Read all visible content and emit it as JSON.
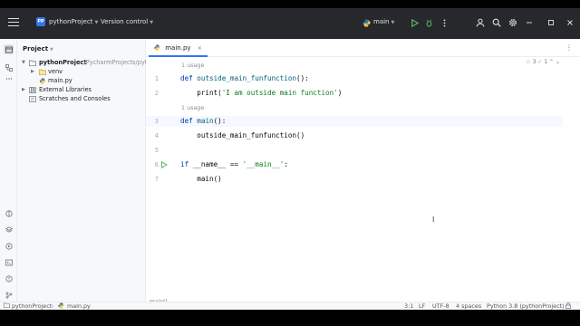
{
  "titlebar": {
    "project_badge": "PP",
    "project_name": "pythonProject",
    "vcs_label": "Version control",
    "run_config": "main",
    "icons": [
      "hamburger-menu-icon",
      "python-icon",
      "run-icon",
      "debug-icon",
      "more-icon",
      "user-icon",
      "search-icon",
      "settings-icon",
      "minimize-icon",
      "maximize-icon",
      "close-icon"
    ]
  },
  "project_panel": {
    "title": "Project",
    "tree": [
      {
        "label": "pythonProject",
        "sub": "~/PycharmProjects/pytho",
        "bold": true
      },
      {
        "label": "venv"
      },
      {
        "label": "main.py"
      },
      {
        "label": "External Libraries"
      },
      {
        "label": "Scratches and Consoles"
      }
    ]
  },
  "editor": {
    "tab_label": "main.py",
    "inspections": {
      "warnings": "3",
      "ok": "1"
    },
    "usage_hint": "1 usage",
    "lines": [
      {
        "n": "1",
        "usage": "1 usage"
      },
      {
        "n": "2"
      },
      {
        "n": "",
        "usage": "1 usage"
      },
      {
        "n": "3"
      },
      {
        "n": "4"
      },
      {
        "n": "5"
      },
      {
        "n": "6"
      },
      {
        "n": "7"
      }
    ],
    "code": {
      "l1_kw": "def ",
      "l1_fn": "outside_main_funfunction",
      "l1_rest": "():",
      "l2_pre": "    print(",
      "l2_str": "'I am outside main function'",
      "l2_post": ")",
      "l3_kw": "def ",
      "l3_fn": "main",
      "l3_rest": "():",
      "l4": "    outside_main_funfunction()",
      "l6_kw": "if ",
      "l6_mid": "__name__ == ",
      "l6_str": "'__main__'",
      "l6_post": ":",
      "l7": "    main()"
    },
    "breadcrumb": "main()"
  },
  "statusbar": {
    "project": "pythonProject",
    "file": "main.py",
    "position": "3:1",
    "line_sep": "LF",
    "encoding": "UTF-8",
    "indent": "4 spaces",
    "interpreter": "Python 3.8 (pythonProject)"
  }
}
